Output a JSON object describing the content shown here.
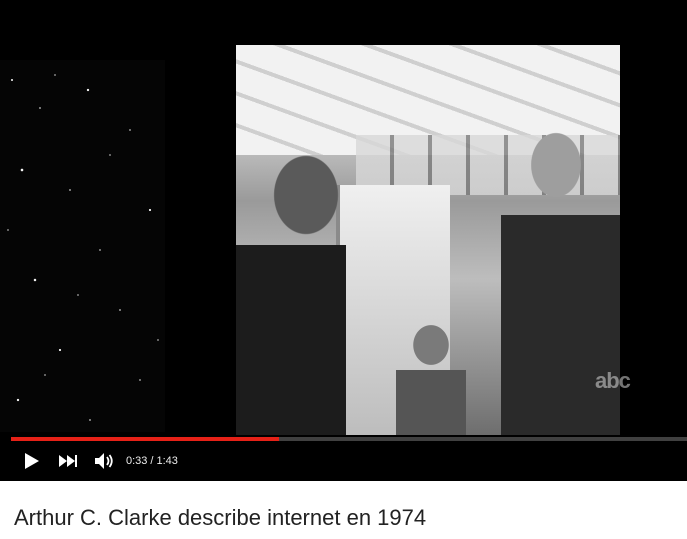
{
  "player": {
    "current_time": "0:33",
    "duration": "1:43",
    "progress": 0.397,
    "watermark": "abc",
    "accent": "#e62117"
  },
  "controls": {
    "play_icon": "play-icon",
    "next_icon": "next-icon",
    "volume_icon": "volume-icon"
  },
  "video": {
    "title": "Arthur C. Clarke describe internet en 1974"
  }
}
